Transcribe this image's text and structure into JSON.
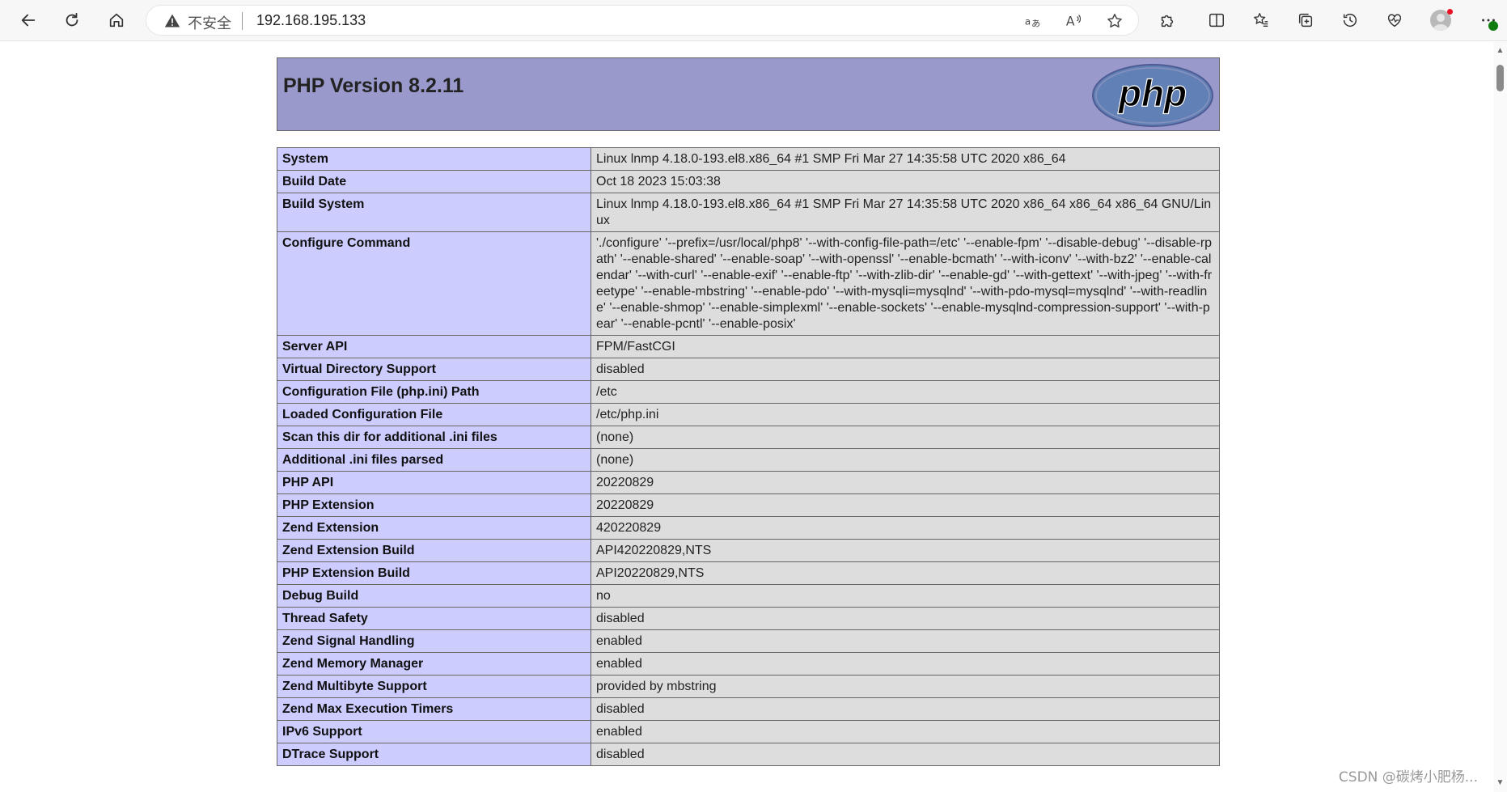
{
  "browser": {
    "security_label": "不安全",
    "url": "192.168.195.133"
  },
  "page": {
    "title": "PHP Version 8.2.11",
    "logo_text": "php",
    "rows": [
      {
        "key": "System",
        "value": "Linux lnmp 4.18.0-193.el8.x86_64 #1 SMP Fri Mar 27 14:35:58 UTC 2020 x86_64"
      },
      {
        "key": "Build Date",
        "value": "Oct 18 2023 15:03:38"
      },
      {
        "key": "Build System",
        "value": "Linux lnmp 4.18.0-193.el8.x86_64 #1 SMP Fri Mar 27 14:35:58 UTC 2020 x86_64 x86_64 x86_64 GNU/Linux"
      },
      {
        "key": "Configure Command",
        "value": "'./configure' '--prefix=/usr/local/php8' '--with-config-file-path=/etc' '--enable-fpm' '--disable-debug' '--disable-rpath' '--enable-shared' '--enable-soap' '--with-openssl' '--enable-bcmath' '--with-iconv' '--with-bz2' '--enable-calendar' '--with-curl' '--enable-exif' '--enable-ftp' '--with-zlib-dir' '--enable-gd' '--with-gettext' '--with-jpeg' '--with-freetype' '--enable-mbstring' '--enable-pdo' '--with-mysqli=mysqlnd' '--with-pdo-mysql=mysqlnd' '--with-readline' '--enable-shmop' '--enable-simplexml' '--enable-sockets' '--enable-mysqlnd-compression-support' '--with-pear' '--enable-pcntl' '--enable-posix'"
      },
      {
        "key": "Server API",
        "value": "FPM/FastCGI"
      },
      {
        "key": "Virtual Directory Support",
        "value": "disabled"
      },
      {
        "key": "Configuration File (php.ini) Path",
        "value": "/etc"
      },
      {
        "key": "Loaded Configuration File",
        "value": "/etc/php.ini"
      },
      {
        "key": "Scan this dir for additional .ini files",
        "value": "(none)"
      },
      {
        "key": "Additional .ini files parsed",
        "value": "(none)"
      },
      {
        "key": "PHP API",
        "value": "20220829"
      },
      {
        "key": "PHP Extension",
        "value": "20220829"
      },
      {
        "key": "Zend Extension",
        "value": "420220829"
      },
      {
        "key": "Zend Extension Build",
        "value": "API420220829,NTS"
      },
      {
        "key": "PHP Extension Build",
        "value": "API20220829,NTS"
      },
      {
        "key": "Debug Build",
        "value": "no"
      },
      {
        "key": "Thread Safety",
        "value": "disabled"
      },
      {
        "key": "Zend Signal Handling",
        "value": "enabled"
      },
      {
        "key": "Zend Memory Manager",
        "value": "enabled"
      },
      {
        "key": "Zend Multibyte Support",
        "value": "provided by mbstring"
      },
      {
        "key": "Zend Max Execution Timers",
        "value": "disabled"
      },
      {
        "key": "IPv6 Support",
        "value": "enabled"
      },
      {
        "key": "DTrace Support",
        "value": "disabled"
      }
    ]
  },
  "watermark": "CSDN @碳烤小肥杨..."
}
